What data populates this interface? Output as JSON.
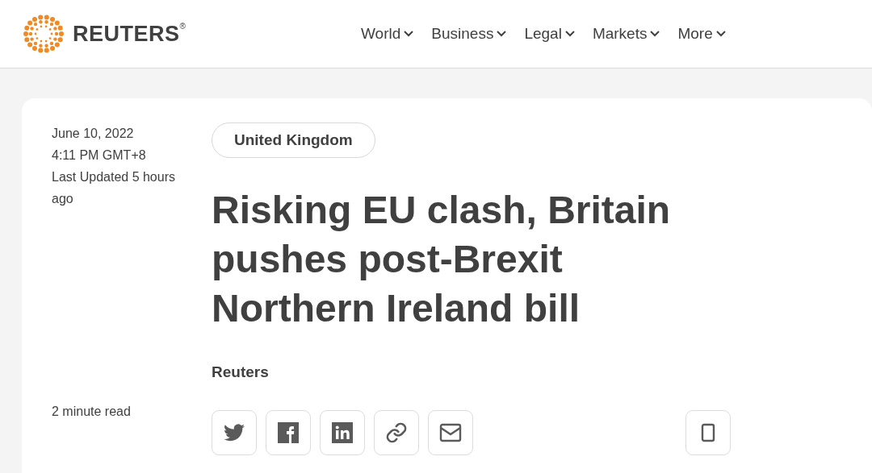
{
  "header": {
    "logo": "REUTERS$^{®}$",
    "nav": [
      {
        "label": "World"
      },
      {
        "label": "Business"
      },
      {
        "label": "Legal"
      },
      {
        "label": "Markets"
      },
      {
        "label": "More"
      }
    ]
  },
  "article": {
    "date": "June 10, 2022",
    "time": "4:11 PM GMT+8",
    "updated": "Last Updated 5 hours ago",
    "read_time": "2 minute read",
    "tag": "United Kingdom",
    "headline": "Risking EU clash, Britain pushes post-Brexit Northern Ireland bill",
    "byline": "Reuters",
    "share": [
      {
        "kind": "twitter"
      },
      {
        "kind": "facebook"
      },
      {
        "kind": "linkedin"
      },
      {
        "kind": "link"
      },
      {
        "kind": "email"
      }
    ]
  }
}
